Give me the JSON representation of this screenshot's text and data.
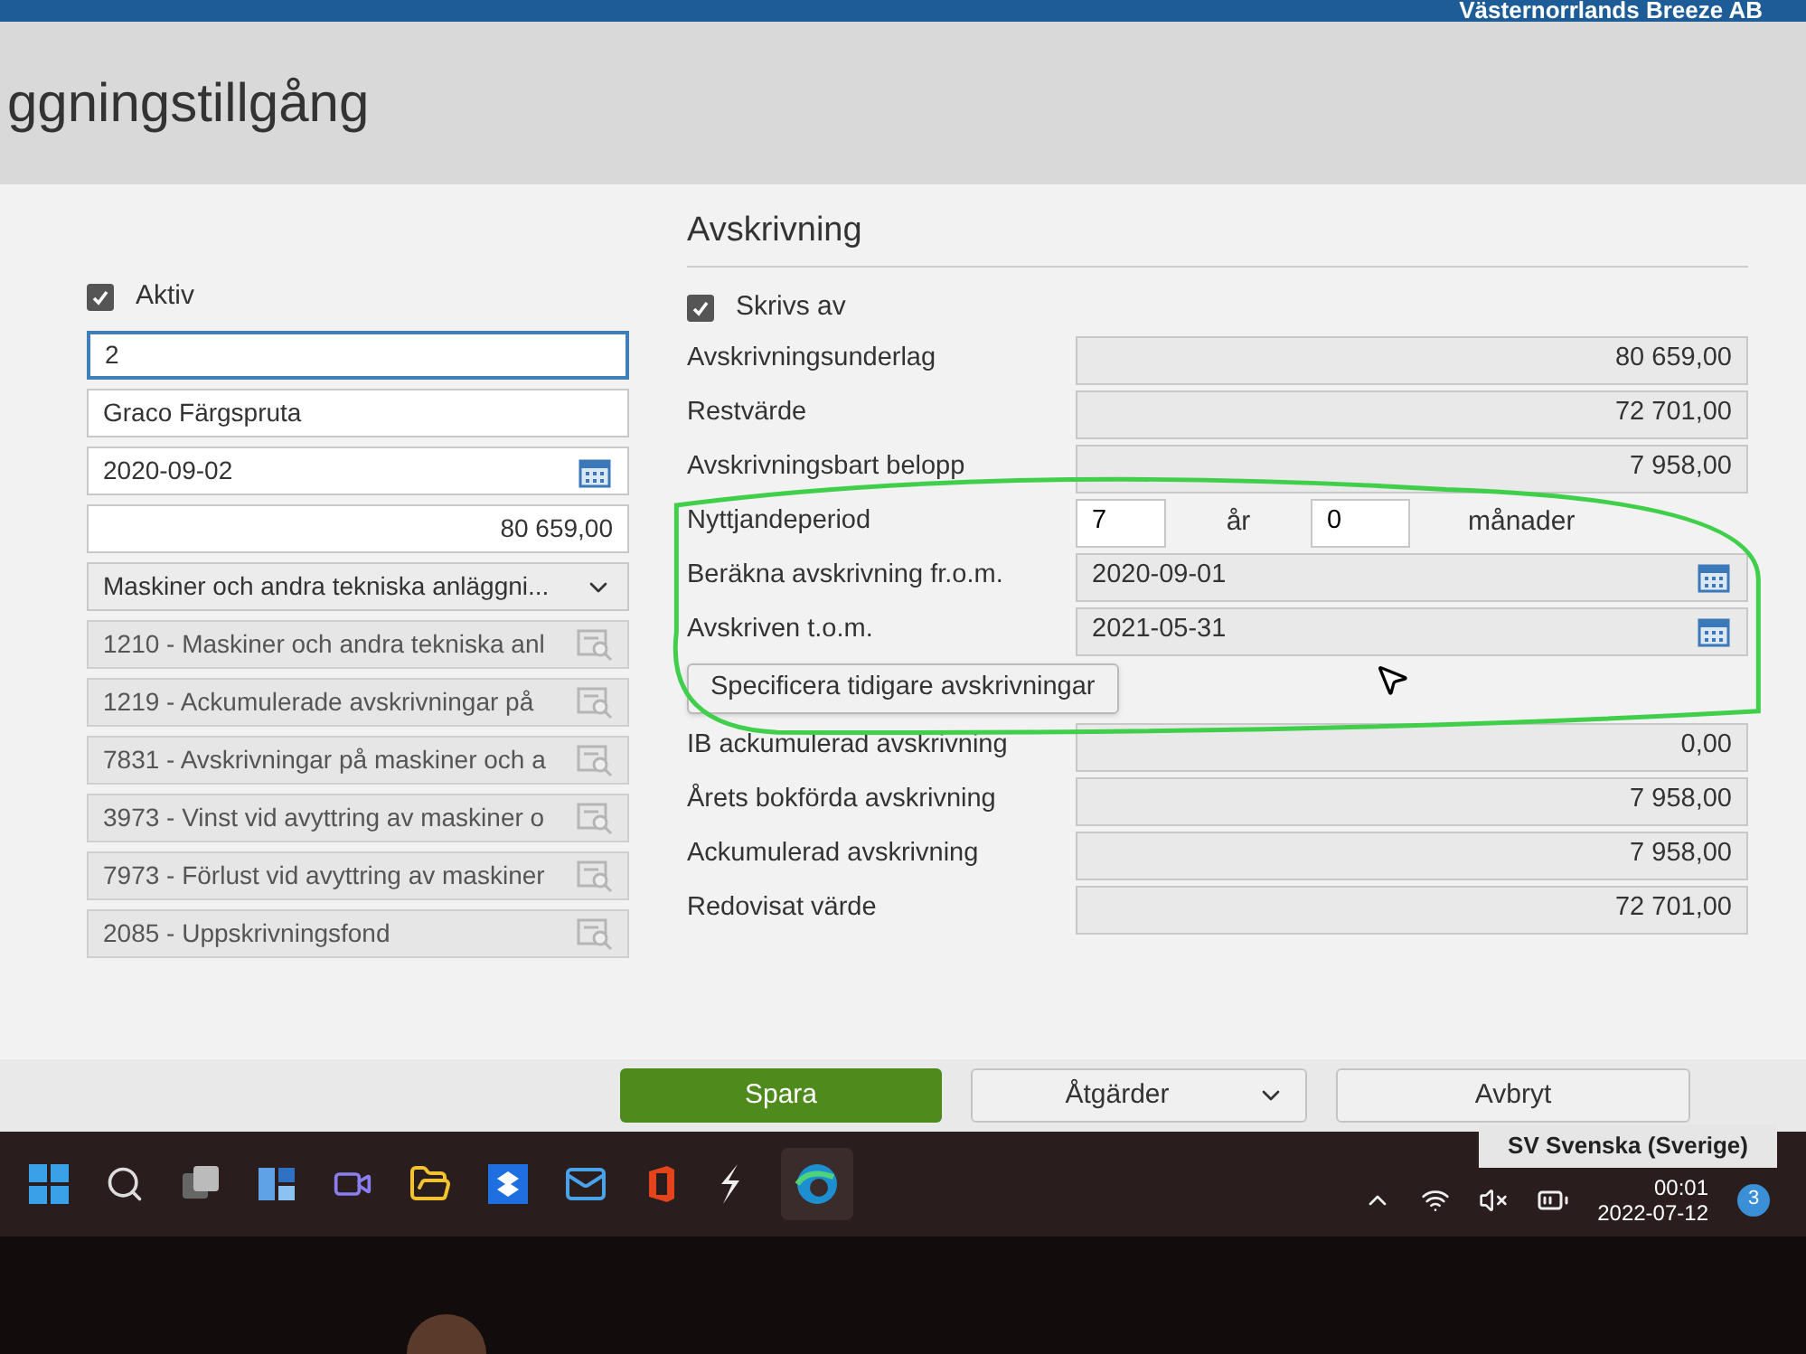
{
  "top_bar": {
    "company": "Västernorrlands Breeze AB"
  },
  "page": {
    "title": "ggningstillgång"
  },
  "left": {
    "checkbox": {
      "label": "Aktiv",
      "checked": true
    },
    "fields": [
      {
        "kind": "text",
        "value": "2",
        "focused": true
      },
      {
        "kind": "text",
        "value": "Graco Färgspruta",
        "focused": false
      },
      {
        "kind": "date",
        "value": "2020-09-02"
      },
      {
        "kind": "amount",
        "value": "80 659,00"
      },
      {
        "kind": "select",
        "value": "Maskiner och andra tekniska anläggni..."
      },
      {
        "kind": "account",
        "value": "1210 - Maskiner och andra tekniska anl"
      },
      {
        "kind": "account",
        "value": "1219 - Ackumulerade avskrivningar på"
      },
      {
        "kind": "account",
        "value": "7831 - Avskrivningar på maskiner och a"
      },
      {
        "kind": "account",
        "value": "3973 - Vinst vid avyttring av maskiner o"
      },
      {
        "kind": "account",
        "value": "7973 - Förlust vid avyttring av maskiner"
      },
      {
        "kind": "account",
        "value": "2085 - Uppskrivningsfond"
      }
    ]
  },
  "right": {
    "heading": "Avskrivning",
    "checkbox": {
      "label": "Skrivs av",
      "checked": true
    },
    "rows": [
      {
        "kind": "amount",
        "label": "Avskrivningsunderlag",
        "value": "80 659,00"
      },
      {
        "kind": "amount",
        "label": "Restvärde",
        "value": "72 701,00"
      },
      {
        "kind": "amount",
        "label": "Avskrivningsbart belopp",
        "value": "7 958,00"
      },
      {
        "kind": "circled_group",
        "rows": [
          {
            "kind": "period",
            "label": "Nyttjandeperiod",
            "years": "7",
            "years_unit": "år",
            "months": "0",
            "months_unit": "månader"
          },
          {
            "kind": "date",
            "label": "Beräkna avskrivning fr.o.m.",
            "value": "2020-09-01"
          },
          {
            "kind": "date",
            "label": "Avskriven t.o.m.",
            "value": "2021-05-31"
          },
          {
            "kind": "button",
            "label": "Specificera tidigare avskrivningar"
          }
        ]
      },
      {
        "kind": "amount",
        "label": "IB ackumulerad avskrivning",
        "value": "0,00"
      },
      {
        "kind": "amount",
        "label": "Årets bokförda avskrivning",
        "value": "7 958,00"
      },
      {
        "kind": "amount",
        "label": "Ackumulerad avskrivning",
        "value": "7 958,00"
      },
      {
        "kind": "amount",
        "label": "Redovisat värde",
        "value": "72 701,00"
      }
    ]
  },
  "actions": [
    {
      "kind": "primary",
      "label": "Spara"
    },
    {
      "kind": "menu",
      "label": "Åtgärder"
    },
    {
      "kind": "plain",
      "label": "Avbryt"
    }
  ],
  "taskbar": {
    "language": "SV Svenska (Sverige)",
    "time": "00:01",
    "date": "2022-07-12",
    "notifications": "3"
  }
}
